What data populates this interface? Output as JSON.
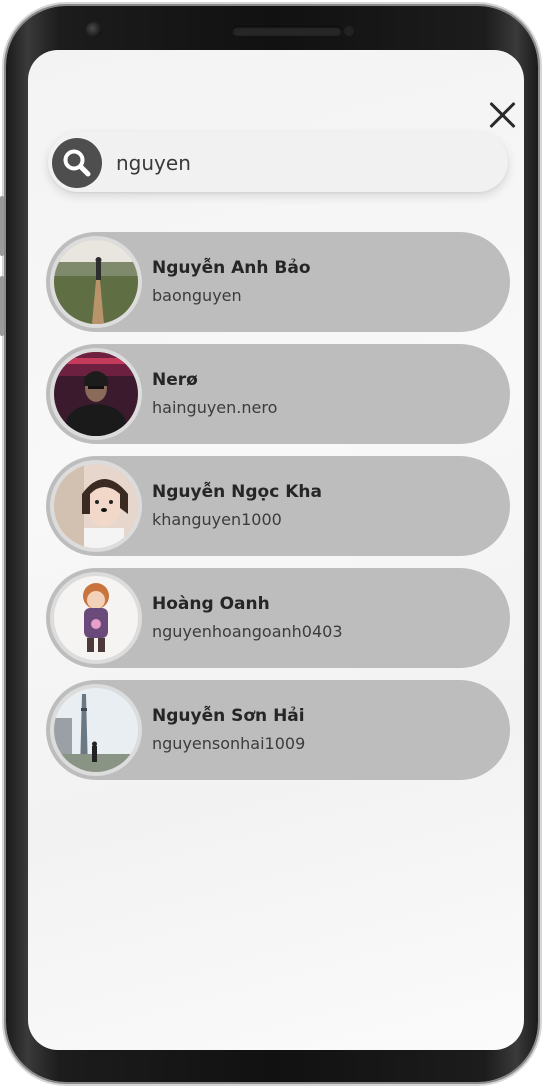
{
  "search": {
    "value": "nguyen",
    "placeholder": ""
  },
  "icons": {
    "search": "search-icon",
    "close": "close-icon"
  },
  "colors": {
    "card_background": "#bdbdbd",
    "search_icon_background": "#4e4e4e",
    "screen_background": "#f4f4f4"
  },
  "results": [
    {
      "name": "Nguyễn Anh Bảo",
      "username": "baonguyen"
    },
    {
      "name": "Nerø",
      "username": "hainguyen.nero"
    },
    {
      "name": "Nguyễn Ngọc Kha",
      "username": "khanguyen1000"
    },
    {
      "name": "Hoàng Oanh",
      "username": "nguyenhoangoanh0403"
    },
    {
      "name": "Nguyễn Sơn Hải",
      "username": "nguyensonhai1009"
    }
  ]
}
